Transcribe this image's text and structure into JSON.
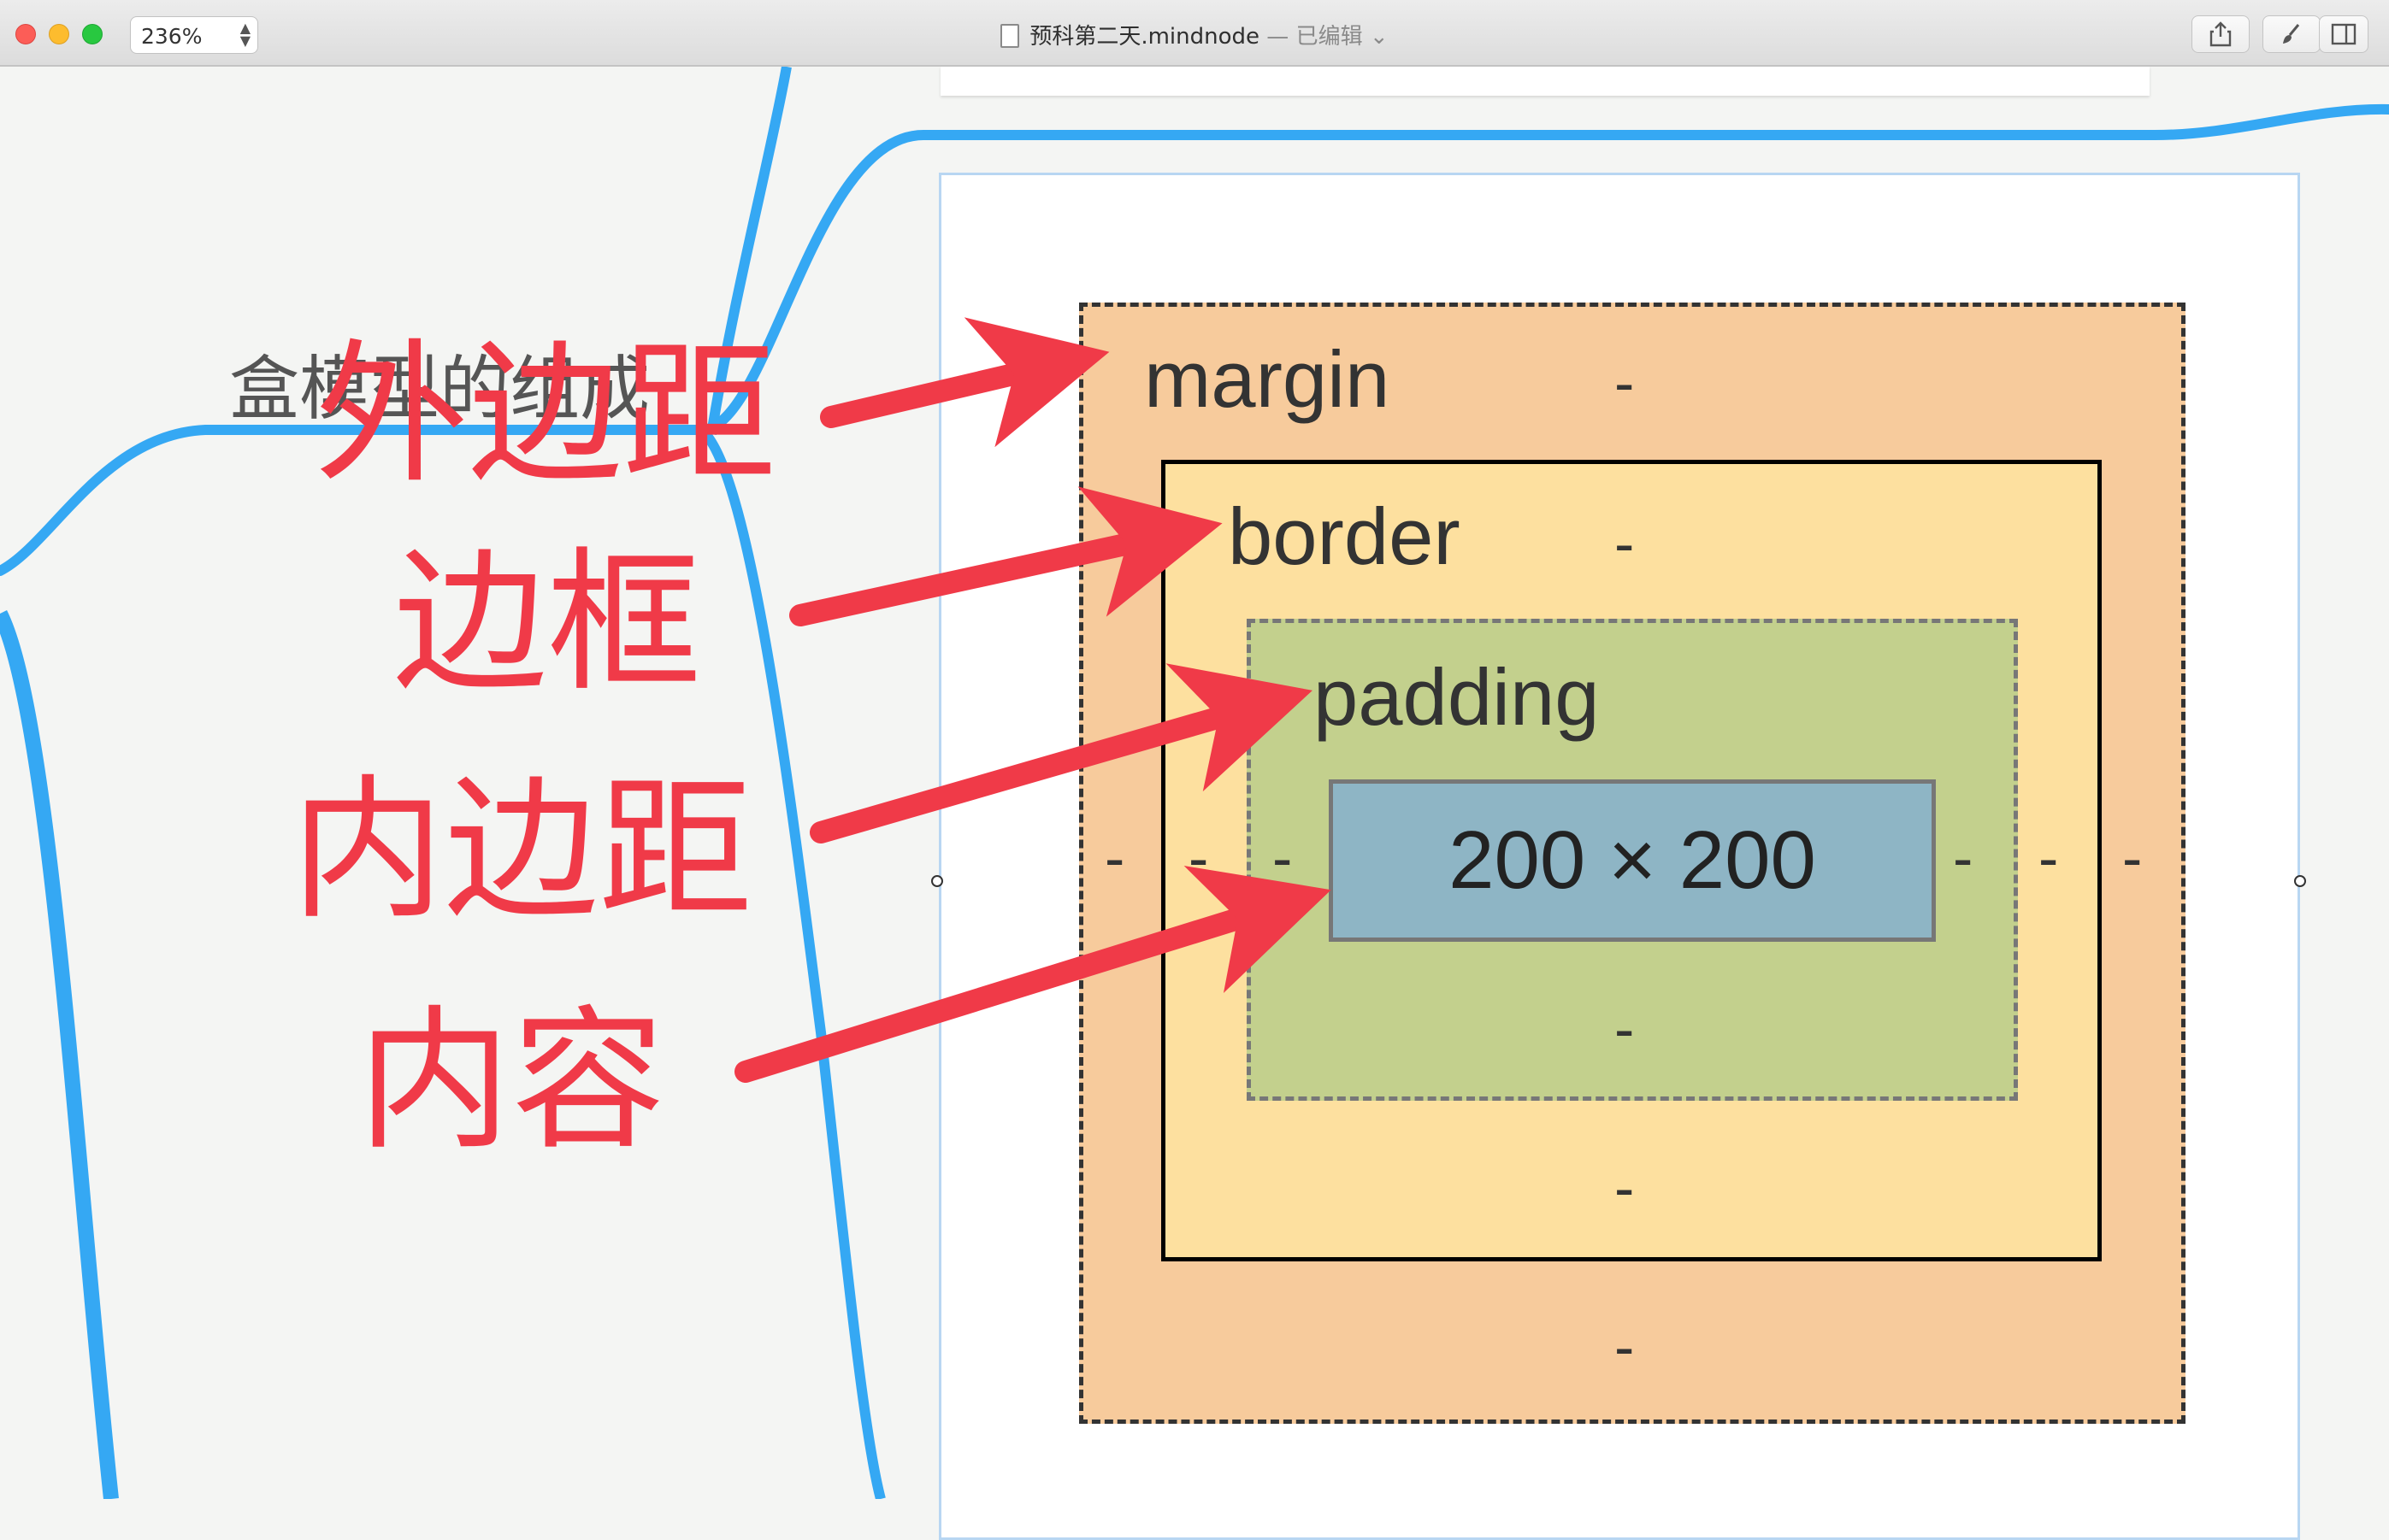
{
  "window": {
    "zoom": "236%",
    "filename": "预科第二天.mindnode",
    "separator": " — ",
    "status": "已编辑"
  },
  "mindmap": {
    "node_text": "盒模型的组成"
  },
  "diagram": {
    "margin_label": "margin",
    "border_label": "border",
    "padding_label": "padding",
    "content_label": "200 × 200",
    "dash": "-"
  },
  "annotations": {
    "margin": "外边距",
    "border": "边框",
    "padding": "内边距",
    "content": "内容"
  },
  "colors": {
    "margin": "#f7cb9c",
    "border": "#fde09f",
    "padding": "#c3d08d",
    "content": "#8eb5c5",
    "annotation": "#f03a48",
    "connector": "#35a8f3"
  },
  "icons": {
    "share": "share-icon",
    "brush": "brush-icon",
    "sidebar": "sidebar-icon"
  }
}
